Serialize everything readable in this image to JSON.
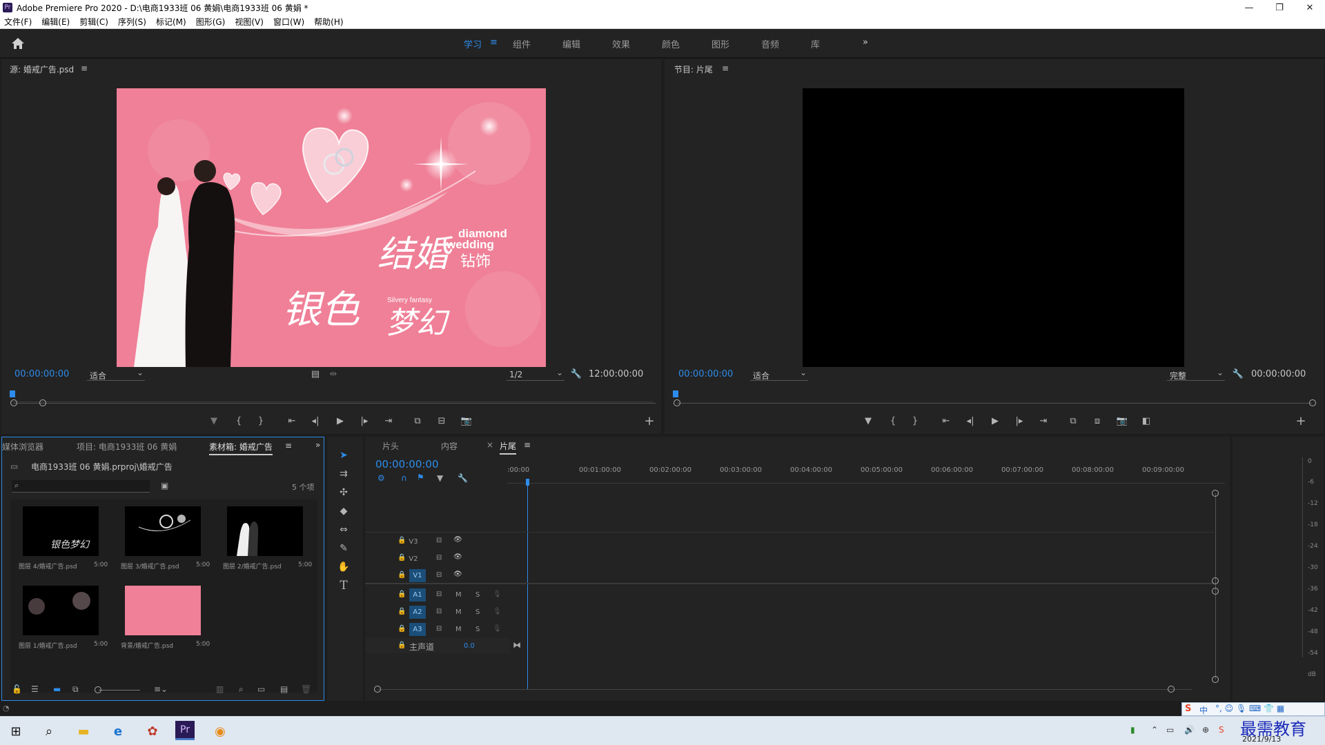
{
  "window": {
    "title": "Adobe Premiere Pro 2020 - D:\\电商1933班  06  黄娟\\电商1933班  06  黄娟 *",
    "app_icon": "Pr",
    "controls": [
      "—",
      "❐",
      "✕"
    ]
  },
  "menu": [
    "文件(F)",
    "编辑(E)",
    "剪辑(C)",
    "序列(S)",
    "标记(M)",
    "图形(G)",
    "视图(V)",
    "窗口(W)",
    "帮助(H)"
  ],
  "workspaces": {
    "items": [
      "学习",
      "组件",
      "编辑",
      "效果",
      "颜色",
      "图形",
      "音频",
      "库"
    ],
    "active": "学习",
    "more": "»",
    "menu_icon": "≡"
  },
  "source": {
    "title": "源: 婚戒广告.psd",
    "menu_icon": "≡",
    "timecode": "00:00:00:00",
    "zoom": "适合",
    "resolution": "1/2",
    "duration": "12:00:00:00",
    "image_text": {
      "cn1": "结婚",
      "cn2": "钻饰",
      "cn3": "银色",
      "cn4": "梦幻",
      "en1": "diamond",
      "en2": "wedding",
      "en3": "Silvery fantasy"
    }
  },
  "program": {
    "title": "节目: 片尾",
    "menu_icon": "≡",
    "timecode": "00:00:00:00",
    "zoom": "适合",
    "resolution": "完整",
    "duration": "00:00:00:00"
  },
  "project": {
    "tabs": [
      "媒体浏览器",
      "项目: 电商1933班  06  黄娟",
      "素材箱: 婚戒广告"
    ],
    "active_tab": "素材箱: 婚戒广告",
    "more": "»",
    "path": "电商1933班  06  黄娟.prproj\\婚戒广告",
    "search_placeholder": "",
    "item_count": "5 个项",
    "items": [
      {
        "name": "图层 4/婚戒广告.psd",
        "dur": "5:00"
      },
      {
        "name": "图层 3/婚戒广告.psd",
        "dur": "5:00"
      },
      {
        "name": "图层 2/婚戒广告.psd",
        "dur": "5:00"
      },
      {
        "name": "图层 1/婚戒广告.psd",
        "dur": "5:00"
      },
      {
        "name": "背景/婚戒广告.psd",
        "dur": "5:00"
      }
    ]
  },
  "timeline": {
    "tabs": [
      "片头",
      "内容",
      "片尾"
    ],
    "active_tab": "片尾",
    "close_icon": "×",
    "timecode": "00:00:00:00",
    "ruler": [
      ":00:00",
      "00:01:00:00",
      "00:02:00:00",
      "00:03:00:00",
      "00:04:00:00",
      "00:05:00:00",
      "00:06:00:00",
      "00:07:00:00",
      "00:08:00:00",
      "00:09:00:00"
    ],
    "video_tracks": [
      "V3",
      "V2",
      "V1"
    ],
    "audio_tracks": [
      "A1",
      "A2",
      "A3"
    ],
    "audio_flags": {
      "m": "M",
      "s": "S"
    },
    "master": {
      "label": "主声道",
      "value": "0.0"
    }
  },
  "meters": [
    "0",
    "-6",
    "-12",
    "-18",
    "-24",
    "-30",
    "-36",
    "-42",
    "-48",
    "-54",
    "dB"
  ],
  "taskbar": {
    "date": "2021/9/13",
    "watermark": "最需教育",
    "ime": "中",
    "ime_brand": "S"
  },
  "colors": {
    "accent": "#2d8ceb",
    "panel": "#232323",
    "bg": "#1d1d1d",
    "pink": "#ef8097"
  }
}
